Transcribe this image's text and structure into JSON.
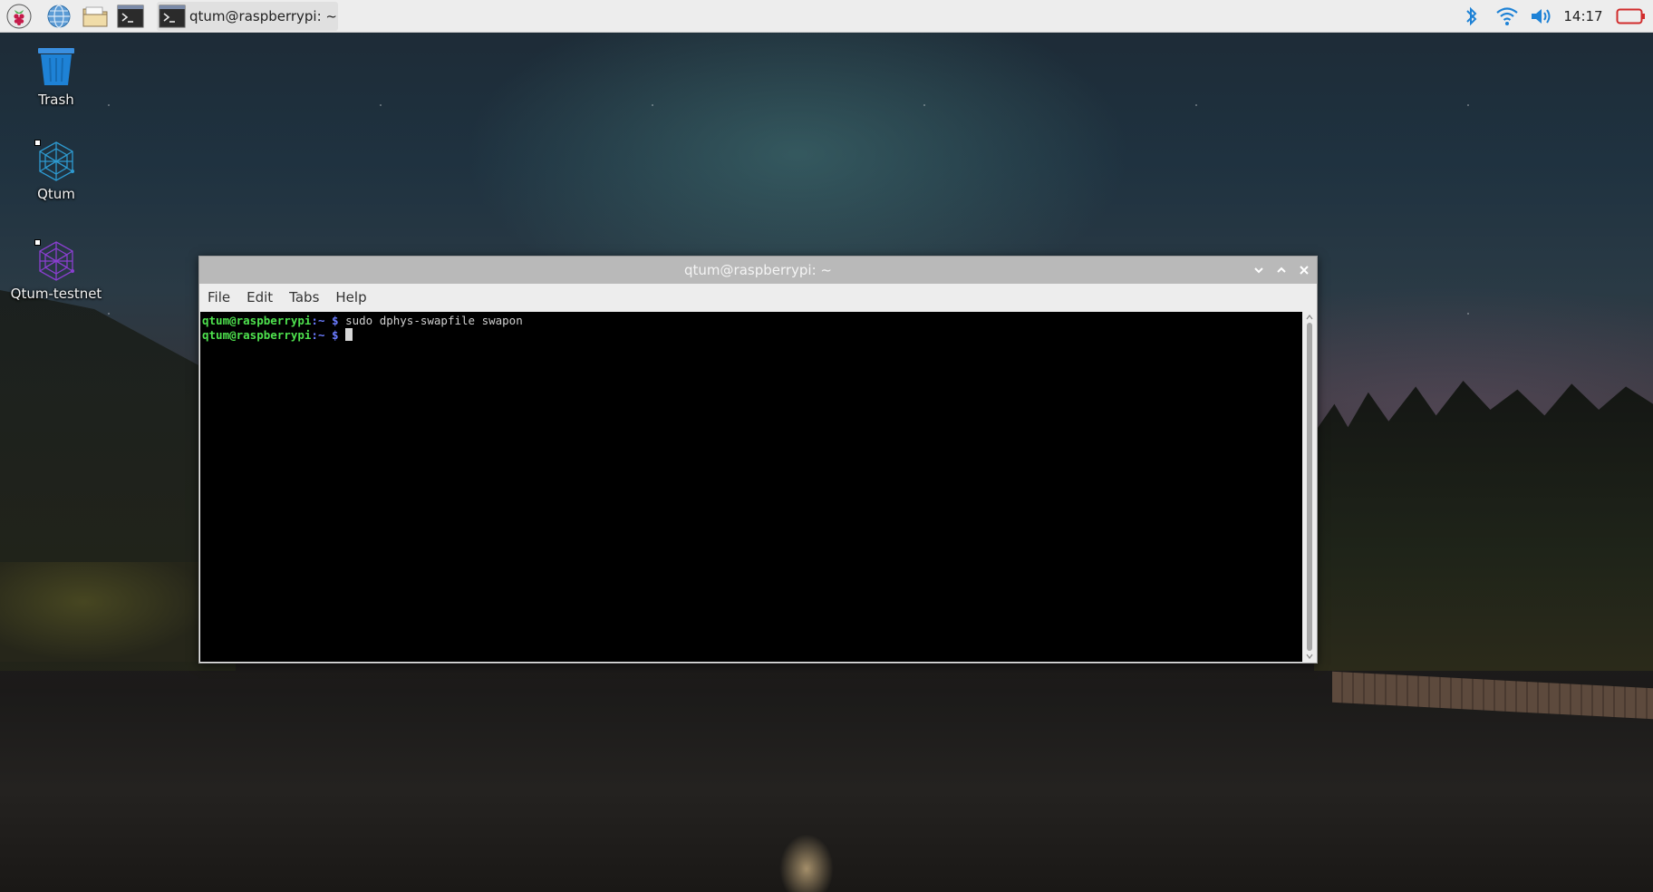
{
  "taskbar": {
    "launchers": [
      {
        "name": "raspberry-menu-icon"
      },
      {
        "name": "web-browser-icon"
      },
      {
        "name": "file-manager-icon"
      },
      {
        "name": "terminal-icon"
      }
    ],
    "active_task": {
      "label": "qtum@raspberrypi: ~",
      "icon": "terminal-icon"
    },
    "tray": {
      "bluetooth": "bluetooth-icon",
      "wifi": "wifi-icon",
      "volume": "volume-icon",
      "clock": "14:17",
      "battery": "battery-icon"
    }
  },
  "desktop": {
    "icons": [
      {
        "label": "Trash",
        "icon": "trash-icon"
      },
      {
        "label": "Qtum",
        "icon": "qtum-icon"
      },
      {
        "label": "Qtum-testnet",
        "icon": "qtum-testnet-icon"
      }
    ]
  },
  "terminal": {
    "title": "qtum@raspberrypi: ~",
    "menu": [
      "File",
      "Edit",
      "Tabs",
      "Help"
    ],
    "lines": [
      {
        "user": "qtum@raspberrypi",
        "sep": ":",
        "path": "~",
        "prompt": " $ ",
        "command": "sudo dphys-swapfile swapon"
      },
      {
        "user": "qtum@raspberrypi",
        "sep": ":",
        "path": "~",
        "prompt": " $ ",
        "command": ""
      }
    ]
  },
  "colors": {
    "prompt_user": "#4ee14e",
    "prompt_path": "#6b7cff",
    "terminal_bg": "#000000",
    "qtum_icon": "#2e9ad0",
    "qtum_testnet_icon": "#8a3fd0",
    "trash_icon": "#1e82d6",
    "battery": "#d12b2b",
    "tray_icons": "#1e82d6"
  }
}
